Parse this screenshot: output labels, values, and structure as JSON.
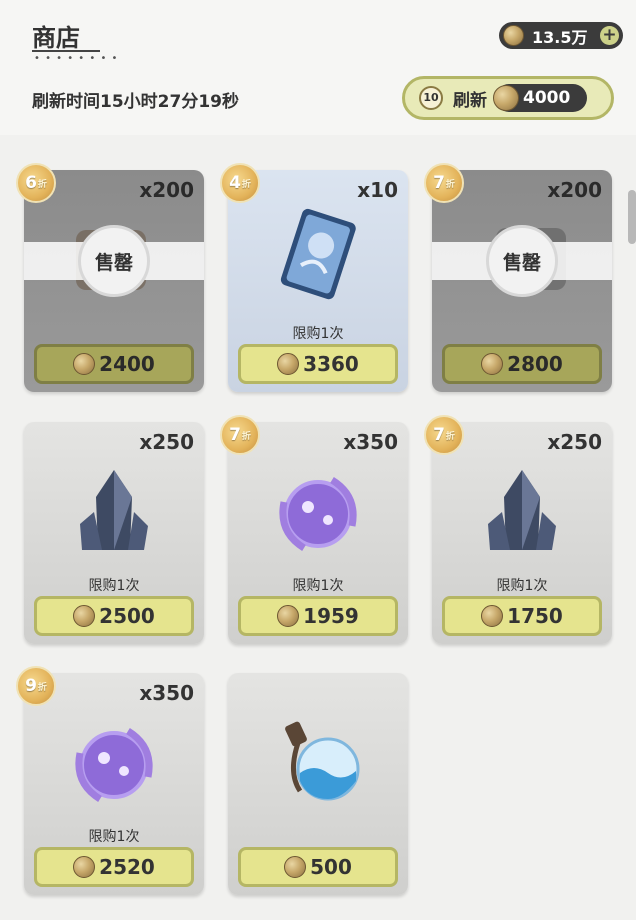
{
  "header": {
    "title": "商店",
    "currency_amount": "13.5万",
    "plus_label": "+",
    "refresh_time": "刷新时间15小时27分19秒",
    "refresh_badge": "10",
    "refresh_label": "刷新",
    "refresh_cost": "4000"
  },
  "items": [
    {
      "quantity": "x200",
      "discount": "6",
      "discount_suffix": "折",
      "sold_label": "售罄",
      "limit": "",
      "price": "2400",
      "state": "sold",
      "icon": "chest-icon"
    },
    {
      "quantity": "x10",
      "discount": "4",
      "discount_suffix": "折",
      "sold_label": "",
      "limit": "限购1次",
      "price": "3360",
      "state": "available",
      "icon": "card-item-icon"
    },
    {
      "quantity": "x200",
      "discount": "7",
      "discount_suffix": "折",
      "sold_label": "售罄",
      "limit": "",
      "price": "2800",
      "state": "sold",
      "icon": "chest-icon"
    },
    {
      "quantity": "x250",
      "discount": "",
      "discount_suffix": "",
      "sold_label": "",
      "limit": "限购1次",
      "price": "2500",
      "state": "available",
      "icon": "crystal-icon"
    },
    {
      "quantity": "x350",
      "discount": "7",
      "discount_suffix": "折",
      "sold_label": "",
      "limit": "限购1次",
      "price": "1959",
      "state": "available",
      "icon": "purple-orb-icon"
    },
    {
      "quantity": "x250",
      "discount": "7",
      "discount_suffix": "折",
      "sold_label": "",
      "limit": "限购1次",
      "price": "1750",
      "state": "available",
      "icon": "crystal-icon"
    },
    {
      "quantity": "x350",
      "discount": "9",
      "discount_suffix": "折",
      "sold_label": "",
      "limit": "限购1次",
      "price": "2520",
      "state": "available",
      "icon": "purple-orb-icon"
    },
    {
      "quantity": "",
      "discount": "",
      "discount_suffix": "",
      "sold_label": "",
      "limit": "",
      "price": "500",
      "state": "available",
      "icon": "blue-potion-icon"
    }
  ]
}
